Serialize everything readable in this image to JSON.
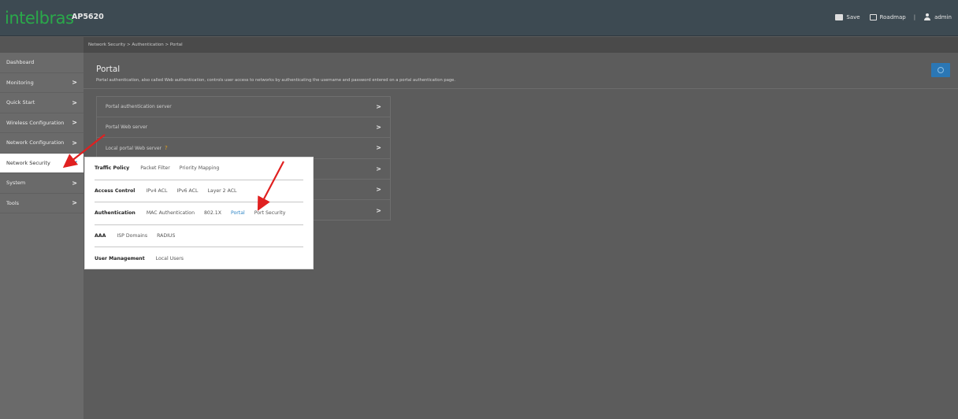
{
  "header": {
    "brand": "intelbras",
    "model": "AP5620",
    "save_label": "Save",
    "roadmap_label": "Roadmap",
    "separator": "|",
    "user_label": "admin"
  },
  "breadcrumb": "Network Security > Authentication > Portal",
  "sidebar": {
    "items": [
      {
        "label": "Dashboard",
        "chev": ""
      },
      {
        "label": "Monitoring",
        "chev": ">"
      },
      {
        "label": "Quick Start",
        "chev": ">"
      },
      {
        "label": "Wireless Configuration",
        "chev": ">"
      },
      {
        "label": "Network Configuration",
        "chev": ">"
      },
      {
        "label": "Network Security",
        "chev": "v"
      },
      {
        "label": "System",
        "chev": ">"
      },
      {
        "label": "Tools",
        "chev": ">"
      }
    ]
  },
  "page": {
    "title": "Portal",
    "description": "Portal authentication, also called Web authentication, controls user access to networks by authenticating the username and password entered on a portal authentication page."
  },
  "list": {
    "rows": [
      {
        "label": "Portal authentication server",
        "chev": ">"
      },
      {
        "label": "Portal Web server",
        "chev": ">"
      },
      {
        "label": "Local portal Web server",
        "chev": ">",
        "tip": "?"
      },
      {
        "label": "",
        "chev": ">"
      },
      {
        "label": "",
        "chev": ">"
      },
      {
        "label": "",
        "chev": ">"
      }
    ]
  },
  "menu": {
    "groups": [
      {
        "category": "Traffic Policy",
        "links": [
          "Packet Filter",
          "Priority Mapping"
        ]
      },
      {
        "category": "Access Control",
        "links": [
          "IPv4 ACL",
          "IPv6 ACL",
          "Layer 2 ACL"
        ]
      },
      {
        "category": "Authentication",
        "links": [
          "MAC Authentication",
          "802.1X",
          "Portal",
          "Port Security"
        ]
      },
      {
        "category": "AAA",
        "links": [
          "ISP Domains",
          "RADIUS"
        ]
      },
      {
        "category": "User Management",
        "links": [
          "Local Users"
        ]
      }
    ],
    "selected": "Portal"
  },
  "colors": {
    "brand_green": "#2aa84a",
    "accent_blue": "#2f86c6",
    "annotation_red": "#e02020"
  }
}
